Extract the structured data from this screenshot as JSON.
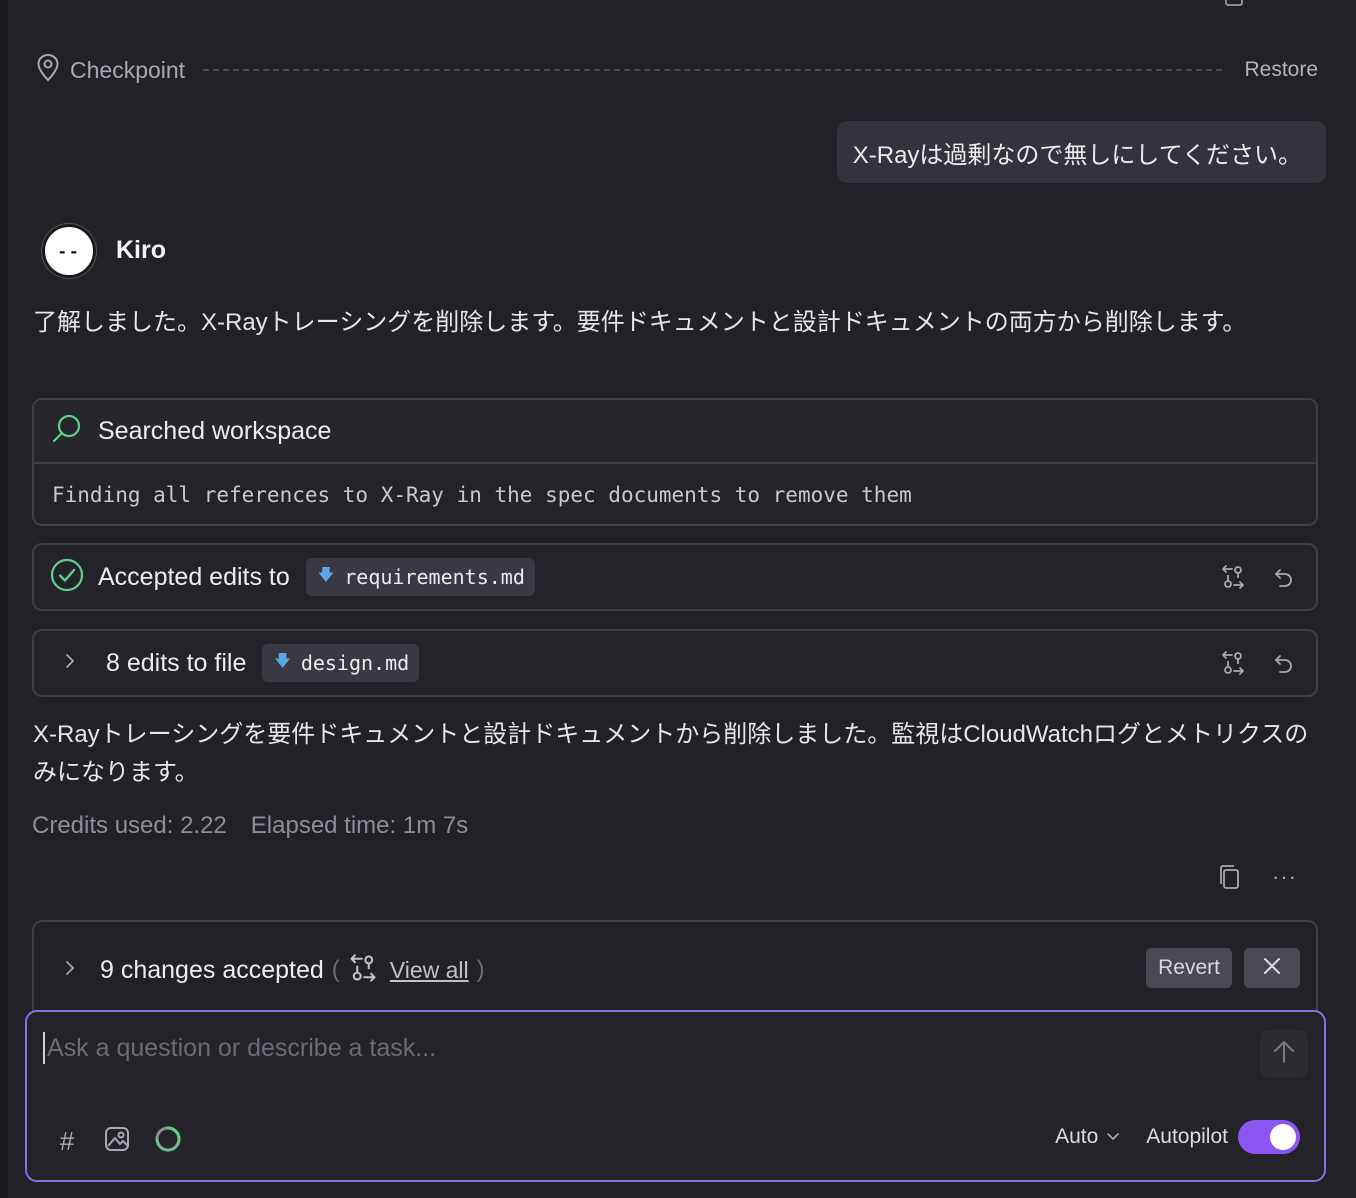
{
  "checkpoint": {
    "label": "Checkpoint",
    "restore": "Restore"
  },
  "user_message": "X-Rayは過剰なので無しにしてください。",
  "assistant": {
    "name": "Kiro",
    "avatar_eyes": "--",
    "intro": "了解しました。X-Rayトレーシングを削除します。要件ドキュメントと設計ドキュメントの両方から削除します。",
    "search_card": {
      "title": "Searched workspace",
      "query": "Finding all references to X-Ray in the spec documents to remove them"
    },
    "accepted_card": {
      "label": "Accepted edits to",
      "file": "requirements.md"
    },
    "edits_card": {
      "label": "8 edits to file",
      "file": "design.md"
    },
    "summary": "X-Rayトレーシングを要件ドキュメントと設計ドキュメントから削除しました。監視はCloudWatchログとメトリクスのみになります。",
    "credits": "Credits used: 2.22",
    "elapsed": "Elapsed time: 1m 7s",
    "more_label": "···"
  },
  "changes_bar": {
    "label": "9 changes accepted",
    "paren_open": "(",
    "paren_close": ")",
    "view_all": "View all",
    "revert": "Revert"
  },
  "composer": {
    "placeholder": "Ask a question or describe a task...",
    "hash": "#",
    "mode": "Auto",
    "autopilot_label": "Autopilot",
    "autopilot_on": true
  },
  "colors": {
    "accent_purple": "#8a55f0",
    "success_green": "#5fcf8c",
    "file_icon_blue": "#5aa7e6"
  }
}
